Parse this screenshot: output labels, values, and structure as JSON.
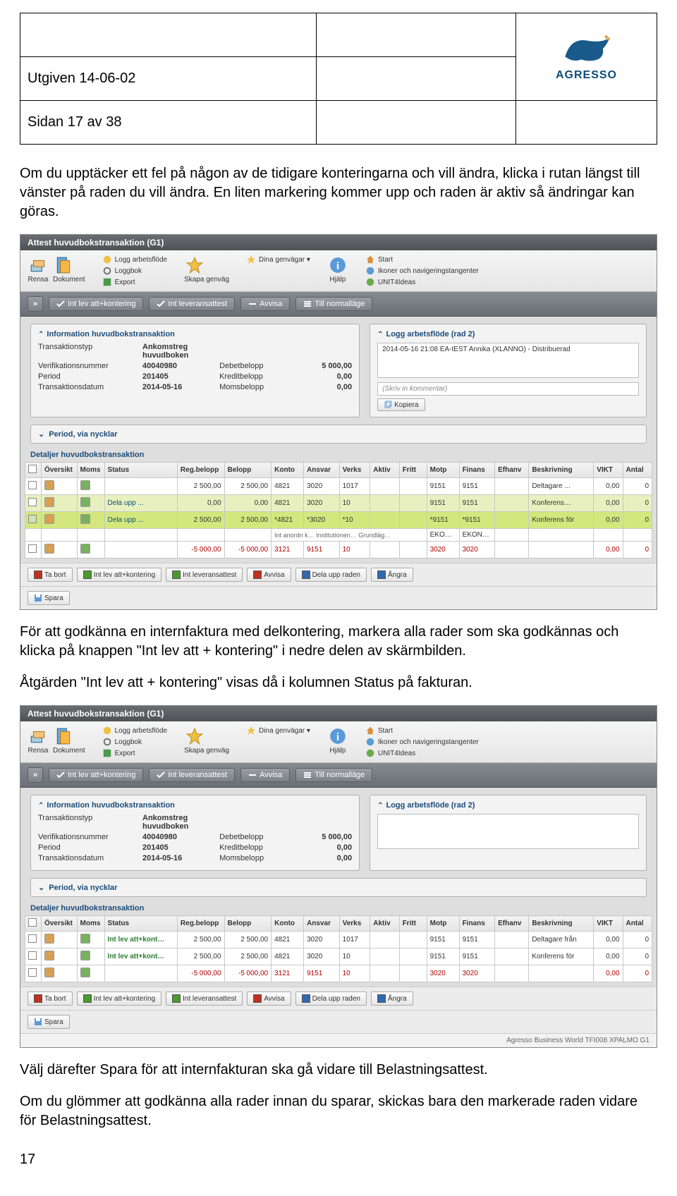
{
  "header": {
    "issued": "Utgiven 14-06-02",
    "page_info": "Sidan 17 av 38",
    "logo_text": "AGRESSO"
  },
  "para1": "Om du upptäcker ett fel på någon av de tidigare konteringarna och vill ändra, klicka i rutan längst till vänster på raden du vill ändra. En liten markering kommer upp och raden är aktiv så ändringar kan göras.",
  "para2": "För att godkänna en internfaktura med delkontering, markera alla rader som ska godkännas och klicka på knappen \"Int lev att + kontering\" i nedre delen av skärmbilden.",
  "para3": "Åtgärden \"Int lev att + kontering\" visas då i kolumnen Status på fakturan.",
  "para4": "Välj därefter Spara för att internfakturan ska gå vidare till Belastningsattest.",
  "para5": "Om du glömmer att godkänna alla rader innan du sparar, skickas bara den markerade raden vidare för Belastningsattest.",
  "page_num": "17",
  "app": {
    "titlebar": "Attest huvudbokstransaktion (G1)",
    "toolbar": {
      "rensa": "Rensa",
      "dokument": "Dokument",
      "logg_arbetsflode": "Logg arbetsflöde",
      "loggbok": "Loggbok",
      "export": "Export",
      "skapa_genvag": "Skapa genväg",
      "dina_genvagar": "Dina genvägar",
      "hjalp": "Hjälp",
      "start": "Start",
      "ikoner": "Ikoner och navigeringstangenter",
      "ideas": "UNIT4Ideas"
    },
    "actions": {
      "int_lev_kont": "Int lev att+kontering",
      "int_lev_attest": "Int leveransattest",
      "avvisa": "Avvisa",
      "normallage": "Till normalläge"
    },
    "infoA": {
      "title": "Information huvudbokstransaktion",
      "transtyp_k": "Transaktionstyp",
      "transtyp_v": "Ankomstreg huvudboken",
      "verif_k": "Verifikationsnummer",
      "verif_v": "40040980",
      "period_k": "Period",
      "period_v": "201405",
      "datum_k": "Transaktionsdatum",
      "datum_v": "2014-05-16",
      "debet_k": "Debetbelopp",
      "debet_v": "5 000,00",
      "kredit_k": "Kreditbelopp",
      "kredit_v": "0,00",
      "moms_k": "Momsbelopp",
      "moms_v": "0,00"
    },
    "infoB": {
      "title": "Logg arbetsflöde (rad 2)",
      "entry": "2014-05-16 21:08 EA-tEST Annika (XLANNO) - Distribuerad",
      "placeholder": "(Skriv in kommentar)",
      "kopiera": "Kopiera"
    },
    "period_nycklar": "Period, via nycklar",
    "detail_title": "Detaljer huvudbokstransaktion",
    "grid": {
      "head": [
        "",
        "Översikt",
        "Moms",
        "Status",
        "Reg.belopp",
        "Belopp",
        "Konto",
        "Ansvar",
        "Verks",
        "Aktiv",
        "Fritt",
        "Motp",
        "Finans",
        "Efhanv",
        "Beskrivning",
        "VIKT",
        "Antal"
      ],
      "rows1": [
        {
          "moms": "",
          "status": "",
          "cls": "",
          "reg": "2 500,00",
          "bel": "2 500,00",
          "konto": "4821",
          "ansvar": "3020",
          "verks": "1017",
          "aktiv": "",
          "fritt": "",
          "motp": "9151",
          "finans": "9151",
          "efh": "",
          "beskr": "Deltagare ...",
          "vikt": "0,00",
          "antal": "0"
        },
        {
          "moms": "",
          "status": "Dela upp ...",
          "cls": "hl",
          "reg": "0,00",
          "bel": "0,00",
          "konto": "4821",
          "ansvar": "3020",
          "verks": "10",
          "aktiv": "",
          "fritt": "",
          "motp": "9151",
          "finans": "9151",
          "efh": "",
          "beskr": "Konferens…",
          "vikt": "0,00",
          "antal": "0"
        },
        {
          "moms": "",
          "status": "Dela upp ...",
          "cls": "sel",
          "reg": "2 500,00",
          "bel": "2 500,00",
          "konto": "*4821",
          "ansvar": "*3020",
          "verks": "*10",
          "aktiv": "",
          "fritt": "",
          "motp": "*9151",
          "finans": "*9151",
          "efh": "",
          "beskr": "Konferens för",
          "vikt": "0,00",
          "antal": "0"
        },
        {
          "moms": "",
          "status": "",
          "cls": "",
          "sub": "Int anordn k… Institutionen… Grundläg…",
          "reg": "",
          "bel": "",
          "konto": "",
          "ansvar": "",
          "verks": "",
          "aktiv": "",
          "fritt": "",
          "motp": "EKONOMI…",
          "finans": "EKONOMI…",
          "efh": "",
          "beskr": "",
          "vikt": "",
          "antal": ""
        },
        {
          "moms": "",
          "status": "",
          "cls": "neg",
          "reg": "-5 000,00",
          "bel": "-5 000,00",
          "konto": "3121",
          "ansvar": "9151",
          "verks": "10",
          "aktiv": "",
          "fritt": "",
          "motp": "3020",
          "finans": "3020",
          "efh": "",
          "beskr": "",
          "vikt": "0,00",
          "antal": "0"
        }
      ],
      "rows2": [
        {
          "moms": "",
          "status": "Int lev att+kont…",
          "cls": "",
          "reg": "2 500,00",
          "bel": "2 500,00",
          "konto": "4821",
          "ansvar": "3020",
          "verks": "1017",
          "aktiv": "",
          "fritt": "",
          "motp": "9151",
          "finans": "9151",
          "efh": "",
          "beskr": "Deltagare från",
          "vikt": "0,00",
          "antal": "0"
        },
        {
          "moms": "",
          "status": "Int lev att+kont…",
          "cls": "",
          "reg": "2 500,00",
          "bel": "2 500,00",
          "konto": "4821",
          "ansvar": "3020",
          "verks": "10",
          "aktiv": "",
          "fritt": "",
          "motp": "9151",
          "finans": "9151",
          "efh": "",
          "beskr": "Konferens för",
          "vikt": "0,00",
          "antal": "0"
        },
        {
          "moms": "",
          "status": "",
          "cls": "neg",
          "reg": "-5 000,00",
          "bel": "-5 000,00",
          "konto": "3121",
          "ansvar": "9151",
          "verks": "10",
          "aktiv": "",
          "fritt": "",
          "motp": "3020",
          "finans": "3020",
          "efh": "",
          "beskr": "",
          "vikt": "0,00",
          "antal": "0"
        }
      ]
    },
    "footbtns": {
      "tabort": "Ta bort",
      "intlevkont": "Int lev att+kontering",
      "intlevattest": "Int leveransattest",
      "avvisa": "Avvisa",
      "delaupp": "Dela upp raden",
      "angra": "Ångra",
      "spara": "Spara"
    },
    "footer_text": "Agresso Business World  TFI008  XPALMO  G1"
  }
}
